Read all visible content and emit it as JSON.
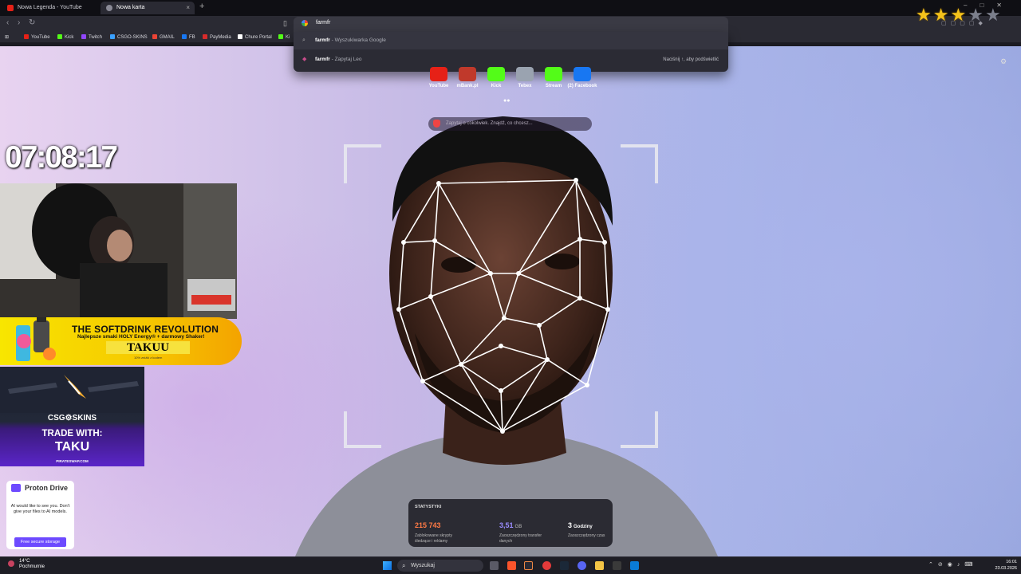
{
  "tabs": [
    {
      "title": "Nowa Legenda - YouTube",
      "favicon_color": "#e62117"
    },
    {
      "title": "Nowa karta",
      "favicon_color": "#8a8a96"
    }
  ],
  "toolbar": {
    "omnibox_value": "farmfr",
    "new_tab_symbol": "+",
    "close_symbol": "×"
  },
  "bookmarks": [
    {
      "label": "YouTube",
      "color": "#e62117"
    },
    {
      "label": "Kick",
      "color": "#53fc18"
    },
    {
      "label": "Twitch",
      "color": "#9146ff"
    },
    {
      "label": "CSGO-SKINS",
      "color": "#3aa0ff"
    },
    {
      "label": "GMAIL",
      "color": "#ea4335"
    },
    {
      "label": "FB",
      "color": "#1877f2"
    },
    {
      "label": "PayMedia",
      "color": "#d62b2b"
    },
    {
      "label": "Chure Portal",
      "color": "#ffffff"
    },
    {
      "label": "Ki",
      "color": "#53fc18"
    }
  ],
  "suggestions": [
    {
      "query": "farmfr",
      "suffix": " - Wyszukiwarka Google"
    },
    {
      "query": "farmfr",
      "suffix": " - Zapytaj Leo",
      "hint": "Naciśnij ↑, aby podświetlić"
    }
  ],
  "rating": {
    "filled": 3,
    "total": 5,
    "filled_color": "#f4c21b",
    "empty_color": "#7b7f8c"
  },
  "top_sites": [
    {
      "label": "YouTube",
      "color": "#e62117"
    },
    {
      "label": "mBank.pl",
      "color": "#c0392b"
    },
    {
      "label": "Kick",
      "color": "#53fc18"
    },
    {
      "label": "Tebex",
      "color": "#9aa3b0"
    },
    {
      "label": "Stream",
      "color": "#53fc18"
    },
    {
      "label": "(2) Facebook",
      "color": "#1877f2"
    }
  ],
  "leo_placeholder": "Zapytaj o cokolwiek. Znajdź, co chcesz...",
  "overlay": {
    "clock": "07:08:17",
    "ad": {
      "title": "THE SOFTDRINK REVOLUTION",
      "subtitle": "Najlepsze smaki HOLY Energy® + darmowy Shaker!",
      "code": "TAKUU",
      "fine": "10% zniżki z kodem"
    },
    "csg": {
      "logo": "CSG⚙SKINS",
      "trade": "TRADE WITH:",
      "name": "TAKU",
      "url": "PIRATESWAP.COM"
    }
  },
  "proton": {
    "name": "Proton Drive",
    "message": "AI would like to see you. Don't give your files to AI models.",
    "button": "Free secure storage"
  },
  "stats": {
    "title": "STATYSTYKI",
    "items": [
      {
        "value": "215 743",
        "unit": "",
        "caption": "Zablokowane skrypty śledzące i reklamy",
        "color": "#ff7a45"
      },
      {
        "value": "3,51",
        "unit": "GB",
        "caption": "Zaoszczędzony transfer danych",
        "color": "#9a8cff"
      },
      {
        "value": "3",
        "unit": "Godziny",
        "caption": "Zaoszczędzony czas",
        "color": "#ffffff"
      }
    ]
  },
  "taskbar": {
    "weather_temp": "14°C",
    "weather_desc": "Pochmurnie",
    "search_label": "Wyszukaj",
    "time": "16:01",
    "date": "23.03.2026"
  }
}
